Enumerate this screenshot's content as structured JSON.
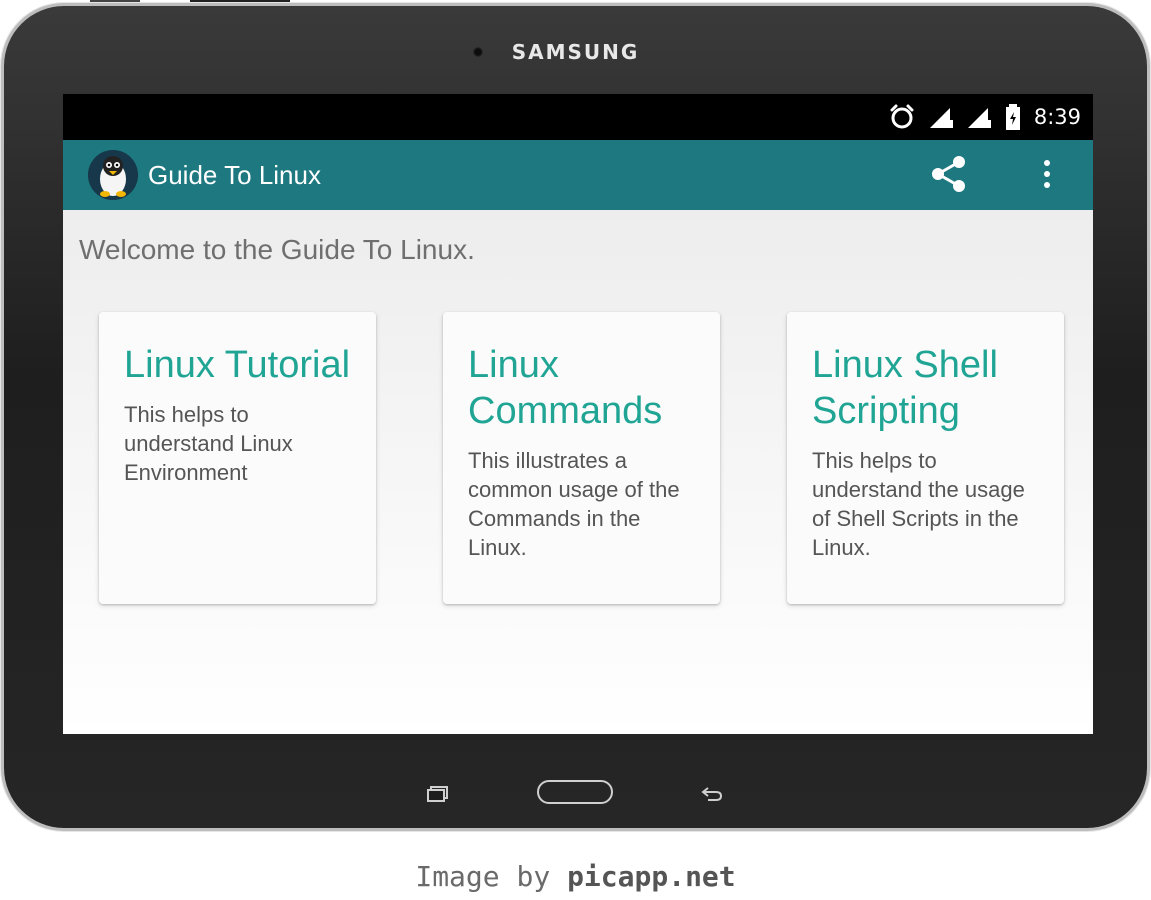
{
  "device": {
    "brand": "SAMSUNG"
  },
  "status_bar": {
    "time": "8:39",
    "icons": [
      "alarm-icon",
      "signal-icon",
      "signal-icon",
      "battery-icon"
    ]
  },
  "app_bar": {
    "title": "Guide To Linux",
    "logo_icon": "tux-logo-icon",
    "actions": [
      "share-icon",
      "overflow-menu-icon"
    ],
    "color": "#1d7880"
  },
  "main": {
    "welcome": "Welcome to the Guide To Linux.",
    "cards": [
      {
        "title": "Linux Tutorial",
        "description": "This helps to understand Linux Environment"
      },
      {
        "title": "Linux Commands",
        "description": "This illustrates a common usage of the Commands in the Linux."
      },
      {
        "title": "Linux Shell Scripting",
        "description": "This helps to understand the usage of Shell Scripts in the Linux."
      }
    ],
    "accent_color": "#20a595"
  },
  "nav_bar": {
    "buttons": [
      "recent-apps-icon",
      "home-button",
      "back-icon"
    ]
  },
  "caption": {
    "prefix": "Image by",
    "site": "picapp.net"
  }
}
